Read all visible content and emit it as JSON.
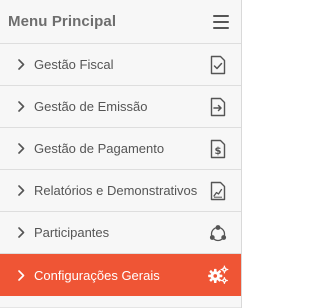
{
  "sidebar": {
    "title": "Menu Principal",
    "items": [
      {
        "label": "Gestão Fiscal",
        "icon": "document-check-icon"
      },
      {
        "label": "Gestão de Emissão",
        "icon": "document-arrow-icon"
      },
      {
        "label": "Gestão de Pagamento",
        "icon": "document-dollar-icon"
      },
      {
        "label": "Relatórios e Demonstrativos",
        "icon": "document-chart-icon"
      },
      {
        "label": "Participantes",
        "icon": "network-icon"
      },
      {
        "label": "Configurações Gerais",
        "icon": "gears-icon",
        "active": true
      }
    ]
  },
  "colors": {
    "accent": "#ef5535",
    "text": "#555555",
    "title": "#6e6e6e",
    "background": "#f7f7f7"
  }
}
